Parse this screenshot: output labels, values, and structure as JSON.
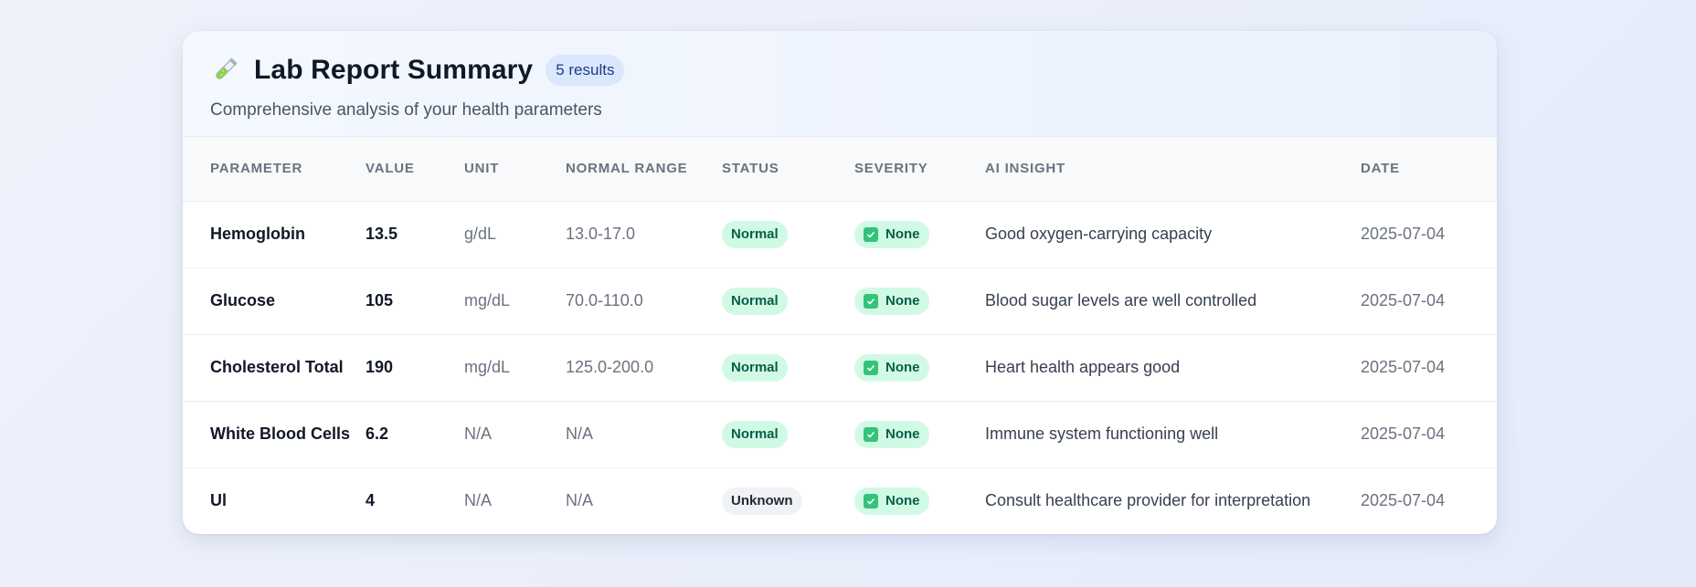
{
  "header": {
    "icon": "test-tube-icon",
    "title": "Lab Report Summary",
    "count_badge": "5 results",
    "subtitle": "Comprehensive analysis of your health parameters"
  },
  "table": {
    "columns": [
      "Parameter",
      "Value",
      "Unit",
      "Normal Range",
      "Status",
      "Severity",
      "AI Insight",
      "Date"
    ],
    "rows": [
      {
        "parameter": "Hemoglobin",
        "value": "13.5",
        "unit": "g/dL",
        "range": "13.0-17.0",
        "status": "Normal",
        "severity": "None",
        "insight": "Good oxygen-carrying capacity",
        "date": "2025-07-04"
      },
      {
        "parameter": "Glucose",
        "value": "105",
        "unit": "mg/dL",
        "range": "70.0-110.0",
        "status": "Normal",
        "severity": "None",
        "insight": "Blood sugar levels are well controlled",
        "date": "2025-07-04"
      },
      {
        "parameter": "Cholesterol Total",
        "value": "190",
        "unit": "mg/dL",
        "range": "125.0-200.0",
        "status": "Normal",
        "severity": "None",
        "insight": "Heart health appears good",
        "date": "2025-07-04"
      },
      {
        "parameter": "White Blood Cells",
        "value": "6.2",
        "unit": "N/A",
        "range": "N/A",
        "status": "Normal",
        "severity": "None",
        "insight": "Immune system functioning well",
        "date": "2025-07-04"
      },
      {
        "parameter": "Ul",
        "value": "4",
        "unit": "N/A",
        "range": "N/A",
        "status": "Unknown",
        "severity": "None",
        "insight": "Consult healthcare provider for interpretation",
        "date": "2025-07-04"
      }
    ]
  },
  "colors": {
    "normal_bg": "#d1fae5",
    "normal_text": "#065f46",
    "unknown_bg": "#f1f2f5",
    "check_green": "#34c37a",
    "badge_bg": "#dbe7fd"
  }
}
